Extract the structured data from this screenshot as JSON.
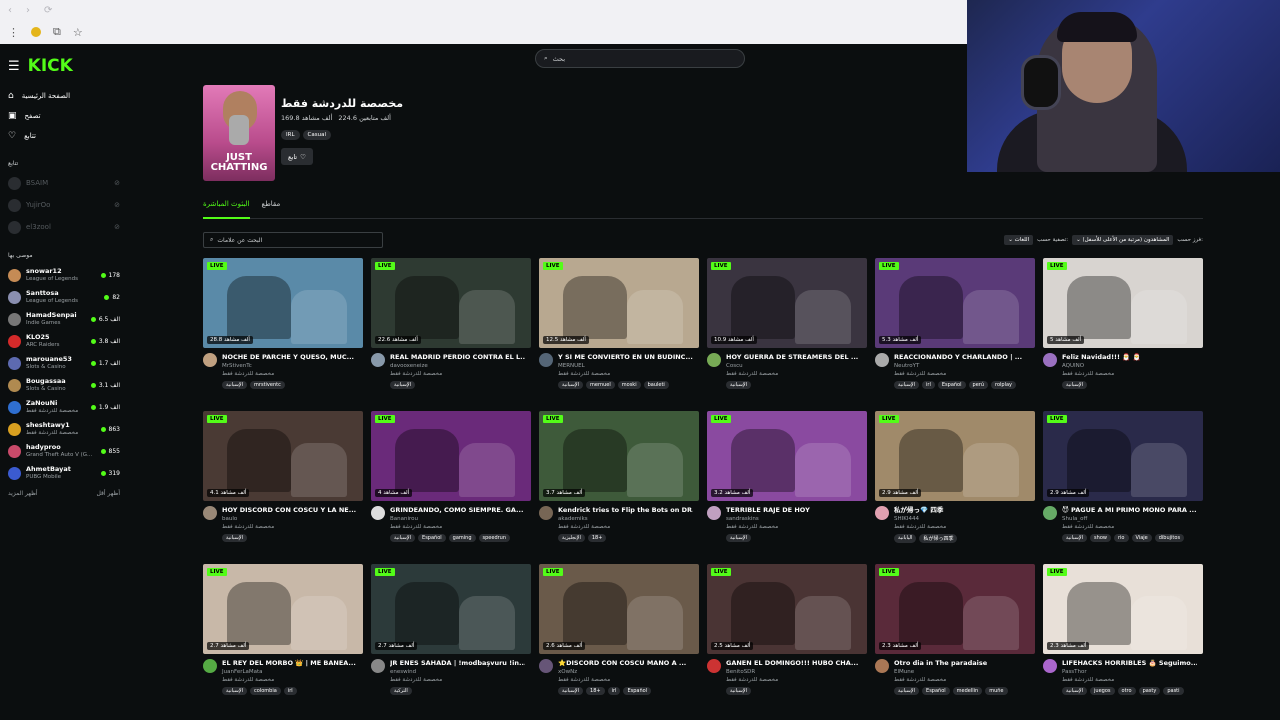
{
  "browser": {
    "back": "‹",
    "fwd": "›",
    "reload": "⟳",
    "dots": "⋮",
    "ext": "⧉",
    "star": "☆"
  },
  "logo": "KICK",
  "nav": [
    {
      "label": "الصفحة الرئيسية",
      "icon": "home-icon",
      "glyph": "⌂"
    },
    {
      "label": "تصفح",
      "icon": "browse-icon",
      "glyph": "▣"
    },
    {
      "label": "تتابع",
      "icon": "heart-icon",
      "glyph": "♡"
    }
  ],
  "following_title": "تتابع",
  "following": [
    {
      "name": "BSAIM"
    },
    {
      "name": "YujirOo"
    },
    {
      "name": "el3zool"
    }
  ],
  "recommended_title": "موصى بها",
  "recommended": [
    {
      "name": "snowar12",
      "cat": "League of Legends",
      "views": "178",
      "color": "#c58b55"
    },
    {
      "name": "Santtosa",
      "cat": "League of Legends",
      "views": "82",
      "color": "#8a8fb0"
    },
    {
      "name": "HamadSenpai",
      "cat": "Indie Games",
      "views": "6.5 الف",
      "color": "#777"
    },
    {
      "name": "KLO25",
      "cat": "ARC Raiders",
      "views": "3.8 الف",
      "color": "#d42a2a"
    },
    {
      "name": "marouane53",
      "cat": "Slots & Casino",
      "views": "1.7 الف",
      "color": "#5d6ab0"
    },
    {
      "name": "Bougassaa",
      "cat": "Slots & Casino",
      "views": "3.1 الف",
      "color": "#b08a50"
    },
    {
      "name": "ZaNouNi",
      "cat": "مخصصة للدردشة فقط",
      "views": "1.9 الف",
      "color": "#2f6fd0"
    },
    {
      "name": "sheshtawy1",
      "cat": "مخصصة للدردشة فقط",
      "views": "863",
      "color": "#d9a020"
    },
    {
      "name": "hadyproo",
      "cat": "Grand Theft Auto V (G...",
      "views": "855",
      "color": "#c94a6a"
    },
    {
      "name": "AhmetBayat",
      "cat": "PUBG Mobile",
      "views": "319",
      "color": "#3b5bd0"
    }
  ],
  "show_more": "أظهر المزيد",
  "show_less": "أظهر أقل",
  "search_placeholder": "بحث",
  "category": {
    "title": "مخصصة للدردشة فقط",
    "followers": "224.6 ألف متابعين",
    "viewers": "169.8 ألف مشاهد",
    "tags": [
      "IRL",
      "Casual"
    ],
    "follow": "تابع",
    "cover_text": "JUST CHATTING"
  },
  "tabs": [
    "البثوث المباشرة",
    "مقاطع"
  ],
  "tag_search_placeholder": "البحث عن علامات",
  "filters": {
    "sort_label": "فرز حسب:",
    "sort_value": "المشاهدون (مرتبة من الأعلى للأسفل)",
    "filter_label": "تصفية حسب:",
    "lang": "اللغات"
  },
  "live_label": "LIVE",
  "streams": [
    {
      "title": "NOCHE DE PARCHE Y QUESO, MUC...",
      "name": "MrStivenTc",
      "cat": "مخصصة للدردشة فقط",
      "views": "28.8 ألف مشاهد",
      "tags": [
        "الإسبانية",
        "mrstiventc"
      ],
      "bg": "#5a8aa8",
      "av": "#c0a080"
    },
    {
      "title": "REAL MADRID PERDIO CONTRA EL L...",
      "name": "davooxeneize",
      "cat": "مخصصة للدردشة فقط",
      "views": "22.6 ألف مشاهد",
      "tags": [
        "الإسبانية"
      ],
      "bg": "#2e3a32",
      "av": "#8899aa"
    },
    {
      "title": "Y SI ME CONVIERTO EN UN BUDINC...",
      "name": "MERNUEL",
      "cat": "مخصصة للدردشة فقط",
      "views": "12.5 ألف مشاهد",
      "tags": [
        "الإسبانية",
        "mernuel",
        "moski",
        "bauleti"
      ],
      "bg": "#b8a890",
      "av": "#556677"
    },
    {
      "title": "HOY GUERRA DE STREAMERS DEL ...",
      "name": "Coscu",
      "cat": "مخصصة للدردشة فقط",
      "views": "10.9 ألف مشاهد",
      "tags": [
        "الإسبانية"
      ],
      "bg": "#3a3440",
      "av": "#77aa55"
    },
    {
      "title": "REACCIONANDO Y CHARLANDO | ...",
      "name": "NeutroYT",
      "cat": "مخصصة للدردشة فقط",
      "views": "5.3 ألف مشاهد",
      "tags": [
        "الإسبانية",
        "irl",
        "Español",
        "perú",
        "rolplay"
      ],
      "bg": "#5a3a78",
      "av": "#aaaaaa"
    },
    {
      "title": "Feliz Navidad!!! 🎅 🎅",
      "name": "AQUINO",
      "cat": "مخصصة للدردشة فقط",
      "views": "5 ألف مشاهد",
      "tags": [
        "الإسبانية"
      ],
      "bg": "#d8d4d0",
      "av": "#9a70c0"
    },
    {
      "title": "HOY DISCORD CON COSCU Y LA NE...",
      "name": "baulo",
      "cat": "مخصصة للدردشة فقط",
      "views": "4.1 ألف مشاهد",
      "tags": [
        "الإسبانية"
      ],
      "bg": "#4a3a34",
      "av": "#998877"
    },
    {
      "title": "GRINDEANDO, COMO SIEMPRE. GA...",
      "name": "Bananirou",
      "cat": "مخصصة للدردشة فقط",
      "views": "4 ألف مشاهد",
      "tags": [
        "الإسبانية",
        "Español",
        "gaming",
        "speedrun"
      ],
      "bg": "#6a2a7a",
      "av": "#dddddd"
    },
    {
      "title": "Kendrick tries to Flip the Bots on DR...",
      "name": "akademiks",
      "cat": "مخصصة للدردشة فقط",
      "views": "3.7 ألف مشاهد",
      "tags": [
        "الإنجليزية",
        "18+"
      ],
      "bg": "#3e5a3a",
      "av": "#776655"
    },
    {
      "title": "TERRIBLE RAJE DE HOY",
      "name": "sandraskins",
      "cat": "مخصصة للدردشة فقط",
      "views": "3.2 ألف مشاهد",
      "tags": [
        "الإسبانية"
      ],
      "bg": "#8a4aa0",
      "av": "#c0a0c0"
    },
    {
      "title": "私が帰っ💎 四季",
      "name": "SHIKI444",
      "cat": "مخصصة للدردشة فقط",
      "views": "2.9 ألف مشاهد",
      "tags": [
        "اليابانية",
        "私が帰っ四季"
      ],
      "bg": "#a08a6a",
      "av": "#e0a0b0"
    },
    {
      "title": "😈 PAGUE A MI PRIMO MONO PARA ...",
      "name": "Shula_off",
      "cat": "مخصصة للدردشة فقط",
      "views": "2.9 ألف مشاهد",
      "tags": [
        "الإسبانية",
        "show",
        "rio",
        "Viaje",
        "dibujitos"
      ],
      "bg": "#2a2a4a",
      "av": "#66aa66"
    },
    {
      "title": "EL REY DEL MORBO 👑 | ME BANEA...",
      "name": "JuanFerLaMata",
      "cat": "مخصصة للدردشة فقط",
      "views": "2.7 ألف مشاهد",
      "tags": [
        "الإسبانية",
        "colombia",
        "irl"
      ],
      "bg": "#c8b8a8",
      "av": "#55aa44"
    },
    {
      "title": "JR ENES SAHADA | !modbaşvuru !in...",
      "name": "eneswind",
      "cat": "مخصصة للدردشة فقط",
      "views": "2.7 ألف مشاهد",
      "tags": [
        "التركية"
      ],
      "bg": "#2c3a3a",
      "av": "#888888"
    },
    {
      "title": "⭐DISCORD CON COSCU MANO A ...",
      "name": "xOwNz",
      "cat": "مخصصة للدردشة فقط",
      "views": "2.6 ألف مشاهد",
      "tags": [
        "الإسبانية",
        "18+",
        "irl",
        "Español"
      ],
      "bg": "#6a5a4a",
      "av": "#665577"
    },
    {
      "title": "GANEN EL DOMINGO!!! HUBO CHA...",
      "name": "BenitoSDR",
      "cat": "مخصصة للدردشة فقط",
      "views": "2.5 ألف مشاهد",
      "tags": [
        "الإسبانية"
      ],
      "bg": "#4a3434",
      "av": "#cc3333"
    },
    {
      "title": "Otro dia in The paradaise",
      "name": "ElMune",
      "cat": "مخصصة للدردشة فقط",
      "views": "2.3 ألف مشاهد",
      "tags": [
        "الإسبانية",
        "Español",
        "medellin",
        "muñe"
      ],
      "bg": "#5a2a3a",
      "av": "#aa7755"
    },
    {
      "title": "LIFEHACKS HORRIBLES 🎂 Seguimo...",
      "name": "PassThor",
      "cat": "مخصصة للدردشة فقط",
      "views": "2.3 ألف مشاهد",
      "tags": [
        "الإسبانية",
        "juegos",
        "otro",
        "pasty",
        "pasti"
      ],
      "bg": "#e8e0d8",
      "av": "#aa66cc"
    }
  ]
}
